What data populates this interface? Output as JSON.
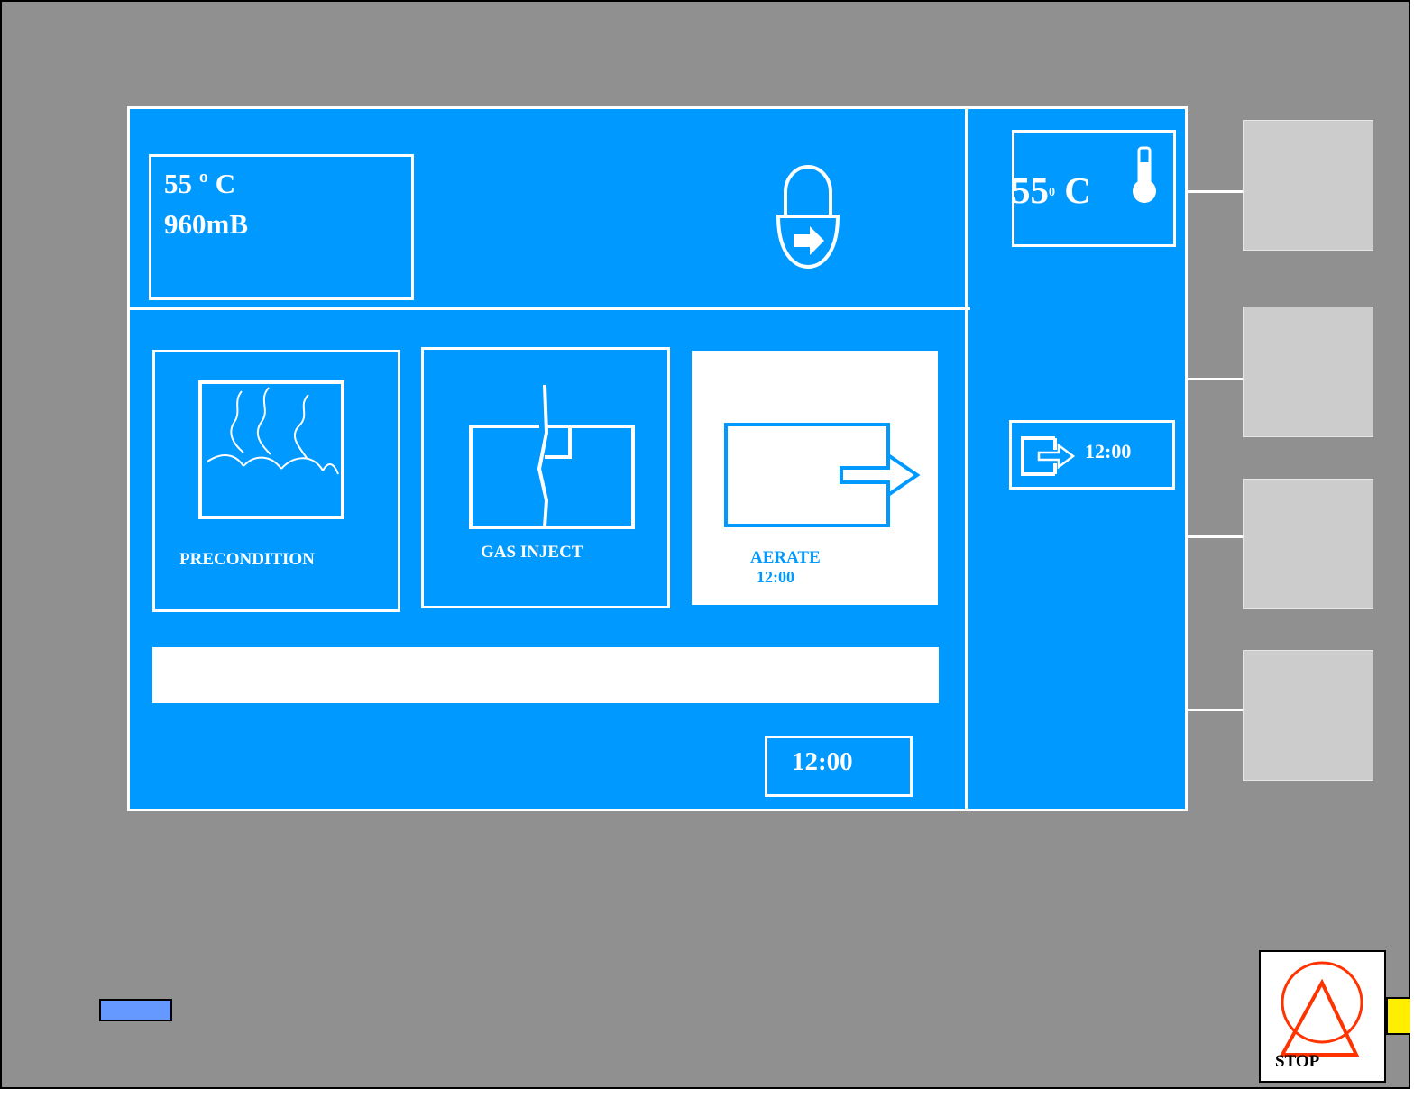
{
  "status_panel": {
    "temperature": "55 º C",
    "pressure": "960mB"
  },
  "header_temp": {
    "value": "55",
    "degree": "0",
    "unit": "C",
    "icon": "thermometer-icon"
  },
  "door_lock": {
    "icon": "door-lock-exit-icon"
  },
  "stages": [
    {
      "label": "PRECONDITION",
      "icon": "precondition-humidity-icon"
    },
    {
      "label": "GAS INJECT",
      "icon": "gas-inject-icon"
    },
    {
      "label": "AERATE",
      "time": "12:00",
      "icon": "aerate-icon",
      "active": true
    }
  ],
  "exit_timer": {
    "time": "12:00",
    "icon": "exit-arrow-icon"
  },
  "total_timer": {
    "time": "12:00"
  },
  "stop_button": {
    "label": "STOP"
  },
  "colors": {
    "screen": "#0099ff",
    "panel": "#909090",
    "softkey": "#cccccc",
    "stop": "#ff3300",
    "indicator_blue": "#6699ff",
    "indicator_yellow": "#ffee00"
  }
}
